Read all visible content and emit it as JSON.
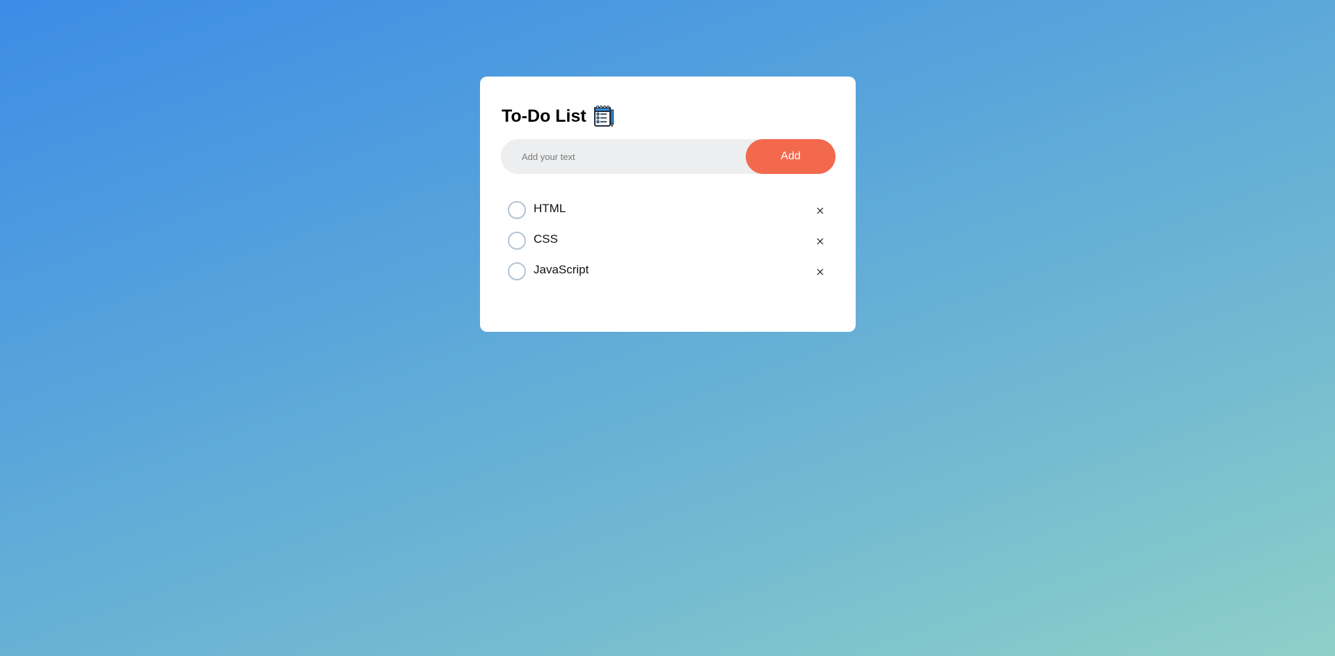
{
  "app": {
    "title": "To-Do List",
    "title_icon": "notepad-checklist-icon"
  },
  "input": {
    "value": "",
    "placeholder": "Add your text"
  },
  "add_button": {
    "label": "Add"
  },
  "todos": [
    {
      "text": "HTML",
      "checked": false,
      "delete_label": "×"
    },
    {
      "text": "CSS",
      "checked": false,
      "delete_label": "×"
    },
    {
      "text": "JavaScript",
      "checked": false,
      "delete_label": "×"
    }
  ],
  "colors": {
    "accent": "#f3694d",
    "card": "#ffffff",
    "input_bg": "#edeef0",
    "checkbox_border": "#b4c2d3",
    "background_start": "#3c8ce6",
    "background_end": "#8ed0c8"
  }
}
